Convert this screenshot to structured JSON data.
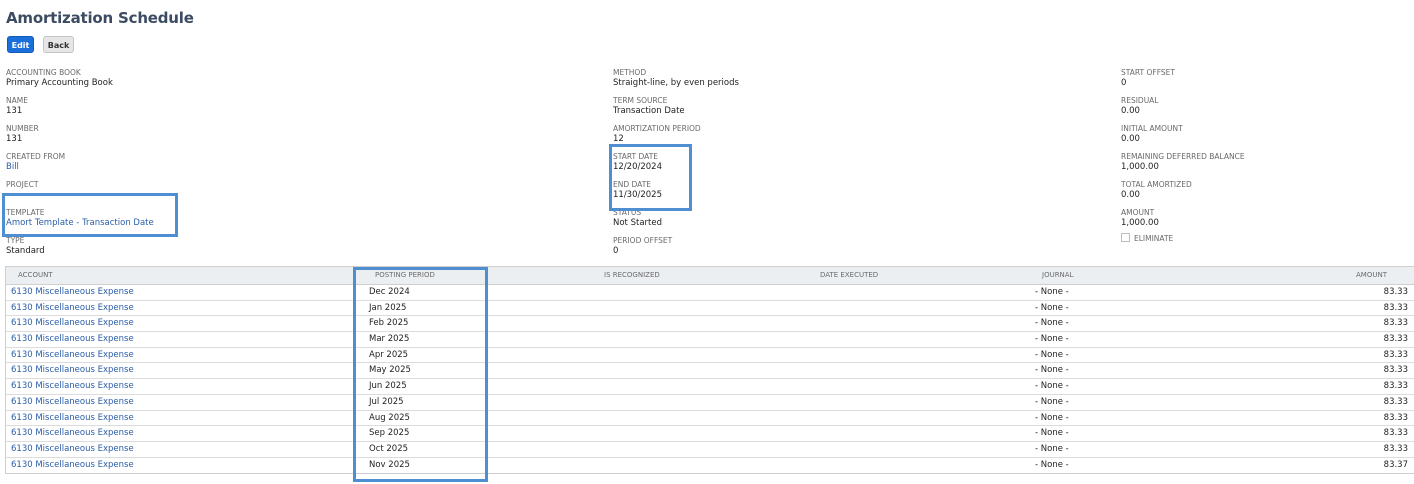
{
  "page_title": "Amortization Schedule",
  "buttons": {
    "edit": "Edit",
    "back": "Back"
  },
  "fields": {
    "col1": [
      {
        "label": "ACCOUNTING BOOK",
        "value": "Primary Accounting Book",
        "link": false
      },
      {
        "label": "NAME",
        "value": "131",
        "link": false
      },
      {
        "label": "NUMBER",
        "value": "131",
        "link": false
      },
      {
        "label": "CREATED FROM",
        "value": "Bill",
        "link": true
      },
      {
        "label": "PROJECT",
        "value": "",
        "link": false
      },
      {
        "label": "TEMPLATE",
        "value": "Amort Template - Transaction Date",
        "link": true
      },
      {
        "label": "TYPE",
        "value": "Standard",
        "link": false
      }
    ],
    "col2": [
      {
        "label": "METHOD",
        "value": "Straight-line, by even periods",
        "link": false
      },
      {
        "label": "TERM SOURCE",
        "value": "Transaction Date",
        "link": false
      },
      {
        "label": "AMORTIZATION PERIOD",
        "value": "12",
        "link": false
      },
      {
        "label": "START DATE",
        "value": "12/20/2024",
        "link": false
      },
      {
        "label": "END DATE",
        "value": "11/30/2025",
        "link": false
      },
      {
        "label": "STATUS",
        "value": "Not Started",
        "link": false
      },
      {
        "label": "PERIOD OFFSET",
        "value": "0",
        "link": false
      }
    ],
    "col3": [
      {
        "label": "START OFFSET",
        "value": "0",
        "link": false
      },
      {
        "label": "RESIDUAL",
        "value": "0.00",
        "link": false
      },
      {
        "label": "INITIAL AMOUNT",
        "value": "0.00",
        "link": false
      },
      {
        "label": "REMAINING DEFERRED BALANCE",
        "value": "1,000.00",
        "link": false
      },
      {
        "label": "TOTAL AMORTIZED",
        "value": "0.00",
        "link": false
      },
      {
        "label": "AMOUNT",
        "value": "1,000.00",
        "link": false
      }
    ],
    "eliminate_label": "ELIMINATE",
    "eliminate_checked": false
  },
  "table": {
    "headers": {
      "account": "ACCOUNT",
      "posting_period": "POSTING PERIOD",
      "is_recognized": "IS RECOGNIZED",
      "date_executed": "DATE EXECUTED",
      "journal": "JOURNAL",
      "amount": "AMOUNT"
    },
    "rows": [
      {
        "account": "6130 Miscellaneous Expense",
        "period": "Dec 2024",
        "journal": "- None -",
        "amount": "83.33"
      },
      {
        "account": "6130 Miscellaneous Expense",
        "period": "Jan 2025",
        "journal": "- None -",
        "amount": "83.33"
      },
      {
        "account": "6130 Miscellaneous Expense",
        "period": "Feb 2025",
        "journal": "- None -",
        "amount": "83.33"
      },
      {
        "account": "6130 Miscellaneous Expense",
        "period": "Mar 2025",
        "journal": "- None -",
        "amount": "83.33"
      },
      {
        "account": "6130 Miscellaneous Expense",
        "period": "Apr 2025",
        "journal": "- None -",
        "amount": "83.33"
      },
      {
        "account": "6130 Miscellaneous Expense",
        "period": "May 2025",
        "journal": "- None -",
        "amount": "83.33"
      },
      {
        "account": "6130 Miscellaneous Expense",
        "period": "Jun 2025",
        "journal": "- None -",
        "amount": "83.33"
      },
      {
        "account": "6130 Miscellaneous Expense",
        "period": "Jul 2025",
        "journal": "- None -",
        "amount": "83.33"
      },
      {
        "account": "6130 Miscellaneous Expense",
        "period": "Aug 2025",
        "journal": "- None -",
        "amount": "83.33"
      },
      {
        "account": "6130 Miscellaneous Expense",
        "period": "Sep 2025",
        "journal": "- None -",
        "amount": "83.33"
      },
      {
        "account": "6130 Miscellaneous Expense",
        "period": "Oct 2025",
        "journal": "- None -",
        "amount": "83.33"
      },
      {
        "account": "6130 Miscellaneous Expense",
        "period": "Nov 2025",
        "journal": "- None -",
        "amount": "83.37"
      }
    ]
  },
  "colors": {
    "highlight": "#4f8fd1",
    "link": "#2a5da8",
    "primary_button": "#1a6fdb",
    "title": "#3c4b62"
  }
}
